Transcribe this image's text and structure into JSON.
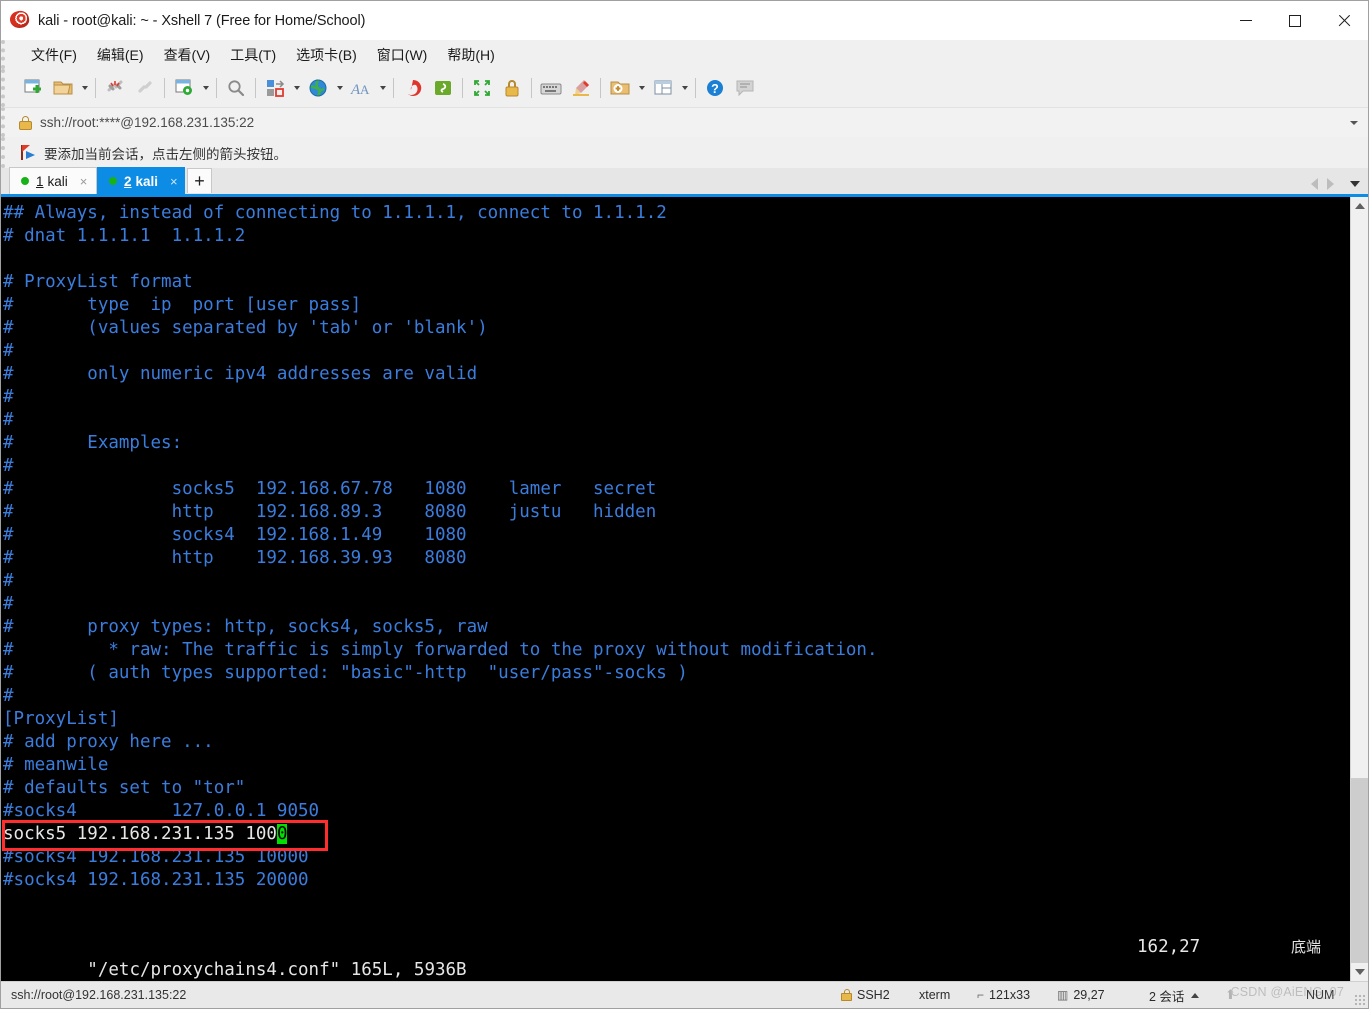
{
  "window": {
    "title": "kali - root@kali: ~ - Xshell 7 (Free for Home/School)",
    "app_icon": "xshell-spiral-icon",
    "minimize_label": "–",
    "maximize_label": "□",
    "close_label": "×"
  },
  "menubar": {
    "items": [
      {
        "label": "文件(F)"
      },
      {
        "label": "编辑(E)"
      },
      {
        "label": "查看(V)"
      },
      {
        "label": "工具(T)"
      },
      {
        "label": "选项卡(B)"
      },
      {
        "label": "窗口(W)"
      },
      {
        "label": "帮助(H)"
      }
    ]
  },
  "toolbar": {
    "items": [
      {
        "name": "new-session-icon"
      },
      {
        "name": "open-folder-icon",
        "caret": true
      },
      {
        "name": "disconnect-icon"
      },
      {
        "name": "reconnect-icon"
      },
      {
        "name": "session-properties-icon",
        "caret": true
      },
      {
        "name": "find-icon"
      },
      {
        "name": "transfer-file-icon",
        "caret": true
      },
      {
        "name": "globe-icon",
        "caret": true
      },
      {
        "name": "font-icon",
        "caret": true
      },
      {
        "name": "xshell-icon"
      },
      {
        "name": "xftp-icon"
      },
      {
        "name": "fullscreen-icon"
      },
      {
        "name": "lock-icon"
      },
      {
        "name": "keyboard-icon"
      },
      {
        "name": "highlight-icon"
      },
      {
        "name": "add-folder-icon",
        "caret": true
      },
      {
        "name": "layout-icon",
        "caret": true
      },
      {
        "name": "help-icon"
      },
      {
        "name": "chat-icon"
      }
    ]
  },
  "address_bar": {
    "icon": "lock-icon",
    "value": "ssh://root:****@192.168.231.135:22",
    "placeholder": "ssh://"
  },
  "notice_bar": {
    "icon": "flag-icon",
    "text": "要添加当前会话，点击左侧的箭头按钮。"
  },
  "tabs": {
    "items": [
      {
        "num": "1",
        "label": "kali",
        "active": false,
        "close": "×",
        "dot": "connected"
      },
      {
        "num": "2",
        "label": "kali",
        "active": true,
        "close": "×",
        "dot": "connected"
      }
    ],
    "add_label": "+",
    "nav_prev": "prev-tab-arrow",
    "nav_next": "next-tab-arrow",
    "nav_list": "tab-list-dropdown"
  },
  "terminal": {
    "lines": [
      {
        "t": "## Always, instead of connecting to 1.1.1.1, connect to 1.1.1.2",
        "c": "blue"
      },
      {
        "t": "# dnat 1.1.1.1  1.1.1.2",
        "c": "blue"
      },
      {
        "t": "",
        "c": "blue"
      },
      {
        "t": "# ProxyList format",
        "c": "blue"
      },
      {
        "t": "#       type  ip  port [user pass]",
        "c": "blue"
      },
      {
        "t": "#       (values separated by 'tab' or 'blank')",
        "c": "blue"
      },
      {
        "t": "#",
        "c": "blue"
      },
      {
        "t": "#       only numeric ipv4 addresses are valid",
        "c": "blue"
      },
      {
        "t": "#",
        "c": "blue"
      },
      {
        "t": "#",
        "c": "blue"
      },
      {
        "t": "#       Examples:",
        "c": "blue"
      },
      {
        "t": "#",
        "c": "blue"
      },
      {
        "t": "#               socks5  192.168.67.78   1080    lamer   secret",
        "c": "blue"
      },
      {
        "t": "#               http    192.168.89.3    8080    justu   hidden",
        "c": "blue"
      },
      {
        "t": "#               socks4  192.168.1.49    1080",
        "c": "blue"
      },
      {
        "t": "#               http    192.168.39.93   8080",
        "c": "blue"
      },
      {
        "t": "#",
        "c": "blue"
      },
      {
        "t": "#",
        "c": "blue"
      },
      {
        "t": "#       proxy types: http, socks4, socks5, raw",
        "c": "blue"
      },
      {
        "t": "#         * raw: The traffic is simply forwarded to the proxy without modification.",
        "c": "blue"
      },
      {
        "t": "#       ( auth types supported: \"basic\"-http  \"user/pass\"-socks )",
        "c": "blue"
      },
      {
        "t": "#",
        "c": "blue"
      },
      {
        "t": "[ProxyList]",
        "c": "blue"
      },
      {
        "t": "# add proxy here ...",
        "c": "blue"
      },
      {
        "t": "# meanwile",
        "c": "blue"
      },
      {
        "t": "# defaults set to \"tor\"",
        "c": "blue"
      },
      {
        "t": "#socks4         127.0.0.1 9050",
        "c": "blue"
      },
      {
        "t": "socks5 192.168.231.135 1000",
        "c": "white",
        "highlight": true,
        "cursor_at_end": true
      },
      {
        "t": "#socks4 192.168.231.135 10000",
        "c": "blue"
      },
      {
        "t": "#socks4 192.168.231.135 20000",
        "c": "blue"
      }
    ],
    "status_file": "\"/etc/proxychains4.conf\" 165L, 5936B",
    "status_position": "162,27",
    "status_end": "底端",
    "cursor_char": "0"
  },
  "statusbar": {
    "url": "ssh://root@192.168.231.135:22",
    "protocol": "SSH2",
    "terminal_type": "xterm",
    "size": "121x33",
    "cursor": "29,27",
    "sessions": "2 会话",
    "num_lock": "NUM",
    "watermark": "CSDN @AiENG_07"
  },
  "colors": {
    "accent": "#0c8ce4",
    "terminal_bg": "#000000",
    "terminal_fg": "#3b7ddd",
    "highlight_border": "#ff2d2d",
    "cursor_bg": "#00e000",
    "connected_dot": "#18b218"
  }
}
